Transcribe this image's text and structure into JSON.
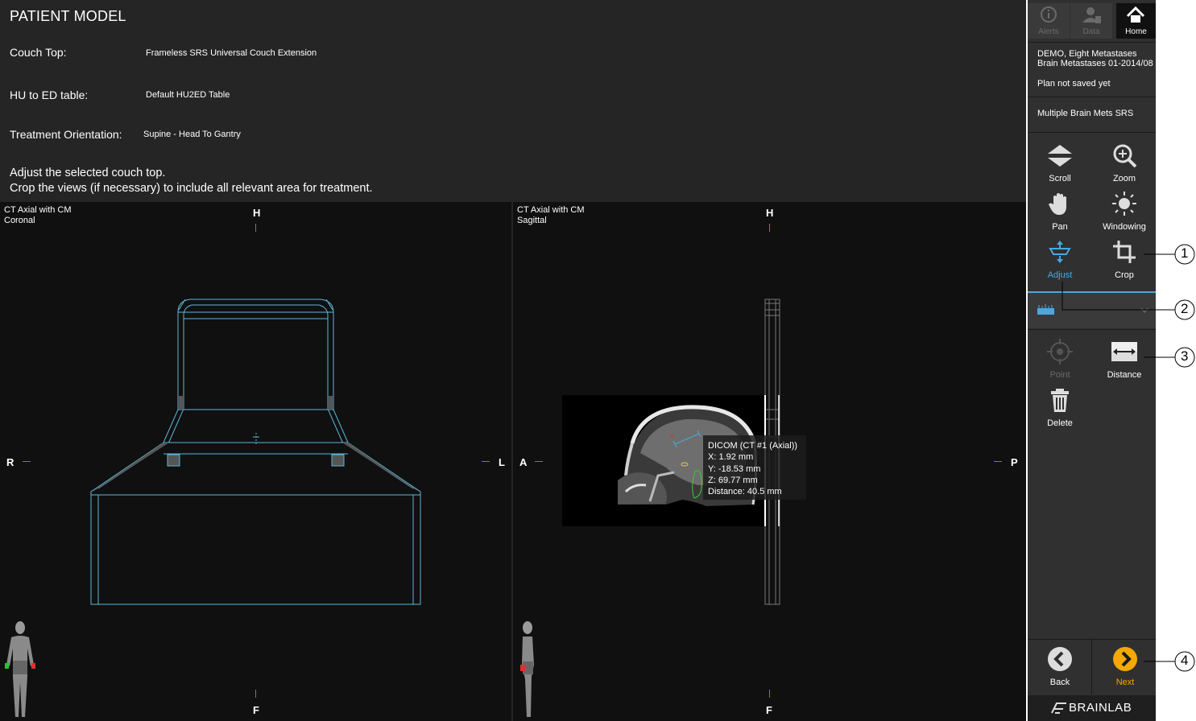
{
  "header": {
    "title": "PATIENT MODEL",
    "couch_top_label": "Couch Top:",
    "couch_top_value": "Frameless SRS Universal Couch Extension",
    "hu_label": "HU to ED table:",
    "hu_value": "Default HU2ED Table",
    "orientation_label": "Treatment Orientation:",
    "orientation_value": "Supine - Head To Gantry",
    "instruction_1": "Adjust the selected couch top.",
    "instruction_2": "Crop the views (if necessary) to include all relevant area for treatment."
  },
  "coronal_view": {
    "caption_1": "CT Axial with CM",
    "caption_2": "Coronal",
    "top": "H",
    "bottom": "F",
    "left": "R",
    "right": "L"
  },
  "sagittal_view": {
    "caption_1": "CT Axial with CM",
    "caption_2": "Sagittal",
    "top": "H",
    "bottom": "F",
    "left": "A",
    "right": "P",
    "tooltip": {
      "line1": "DICOM (CT #1 (Axial))",
      "line2": "X: 1.92 mm",
      "line3": "Y: -18.53 mm",
      "line4": "Z: 69.77 mm",
      "line5": "Distance: 40.5 mm"
    }
  },
  "sidebar": {
    "alerts": "Alerts",
    "data": "Data",
    "home": "Home",
    "patient_line1": "DEMO, Eight Metastases",
    "patient_line2": "Brain Metastases 01-2014/08",
    "plan_status": "Plan not saved yet",
    "plan_name": "Multiple Brain Mets SRS",
    "tools": {
      "scroll": "Scroll",
      "zoom": "Zoom",
      "pan": "Pan",
      "windowing": "Windowing",
      "adjust": "Adjust",
      "crop": "Crop",
      "point": "Point",
      "distance": "Distance",
      "delete": "Delete"
    },
    "back": "Back",
    "next": "Next",
    "brand": "BRAINLAB"
  },
  "callouts": [
    "1",
    "2",
    "3",
    "4"
  ],
  "colors": {
    "accent": "#4aa8e0",
    "next": "#f5a800",
    "couch": "#5bb8d8",
    "background": "#252525"
  }
}
